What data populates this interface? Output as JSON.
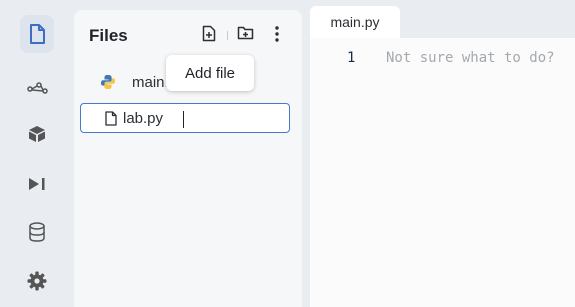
{
  "files_panel": {
    "title": "Files",
    "tooltip": "Add file",
    "items": [
      {
        "label": "main.py",
        "icon": "python-icon"
      }
    ],
    "new_file_input": {
      "value": "lab.py",
      "icon": "file-icon"
    }
  },
  "editor": {
    "tab_label": "main.py",
    "line_number": "1",
    "placeholder": "Not sure what to do?"
  },
  "activity_bar": {
    "icons": [
      "file-icon",
      "share-icon",
      "package-icon",
      "run-icon",
      "database-icon",
      "gear-icon"
    ]
  },
  "colors": {
    "accent": "#3b6fc4",
    "background": "#e9edf2",
    "panel": "#f6f7f9"
  }
}
